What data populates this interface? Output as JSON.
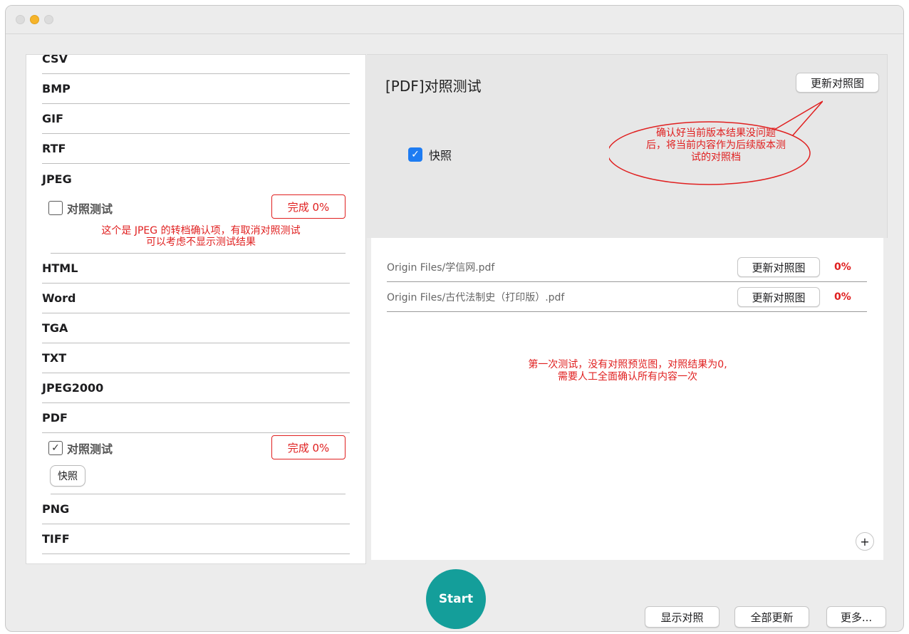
{
  "window": {
    "title": ""
  },
  "left": {
    "formats_top": [
      "CSV",
      "BMP",
      "GIF",
      "RTF",
      "JPEG"
    ],
    "jpeg_check_label": "对照测试",
    "jpeg_done": "完成 0%",
    "jpeg_note_line1": "这个是 JPEG 的转档确认项，有取消对照测试",
    "jpeg_note_line2": "可以考虑不显示测试结果",
    "formats_mid": [
      "HTML",
      "Word",
      "TGA",
      "TXT",
      "JPEG2000",
      "PDF"
    ],
    "pdf_check_label": "对照测试",
    "pdf_done": "完成 0%",
    "pdf_snapshot_button": "快照",
    "formats_bottom": [
      "PNG",
      "TIFF"
    ]
  },
  "right": {
    "title": "[PDF]对照测试",
    "update_button": "更新对照图",
    "callout_line1": "确认好当前版本结果没问题",
    "callout_line2": "后，将当前内容作为后续版本测",
    "callout_line3": "试的对照档",
    "snapshot_label": "快照",
    "files": [
      {
        "name": "Origin Files/学信网.pdf",
        "button": "更新对照图",
        "pct": "0%"
      },
      {
        "name": "Origin Files/古代法制史（打印版）.pdf",
        "button": "更新对照图",
        "pct": "0%"
      }
    ],
    "note_line1": "第一次测试，没有对照预览图，对照结果为0,",
    "note_line2": "需要人工全面确认所有内容一次",
    "plus": "+"
  },
  "bottom": {
    "start": "Start",
    "show_compare": "显示对照",
    "update_all": "全部更新",
    "more": "更多..."
  },
  "colors": {
    "accent_red": "#e02020",
    "start_teal": "#149e9a",
    "checkbox_blue": "#1e7cf2",
    "traffic_yellow": "#f6b42a"
  }
}
